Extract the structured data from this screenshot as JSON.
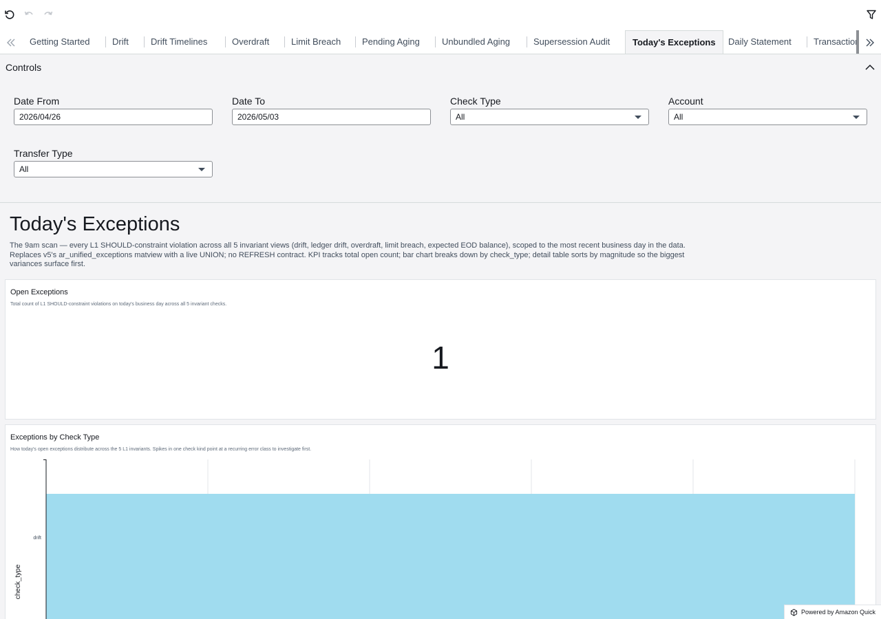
{
  "toolbar": {
    "icons": [
      "reset-icon",
      "undo-icon",
      "redo-icon",
      "filter-icon"
    ]
  },
  "tabs": [
    {
      "label": "Getting Started",
      "active": false
    },
    {
      "label": "Drift",
      "active": false
    },
    {
      "label": "Drift Timelines",
      "active": false
    },
    {
      "label": "Overdraft",
      "active": false
    },
    {
      "label": "Limit Breach",
      "active": false
    },
    {
      "label": "Pending Aging",
      "active": false
    },
    {
      "label": "Unbundled Aging",
      "active": false
    },
    {
      "label": "Supersession Audit",
      "active": false
    },
    {
      "label": "Today's Exceptions",
      "active": true
    },
    {
      "label": "Daily Statement",
      "active": false
    },
    {
      "label": "Transactions",
      "active": false
    }
  ],
  "controls": {
    "title": "Controls",
    "date_from": {
      "label": "Date From",
      "value": "2026/04/26"
    },
    "date_to": {
      "label": "Date To",
      "value": "2026/05/03"
    },
    "check_type": {
      "label": "Check Type",
      "value": "All"
    },
    "account": {
      "label": "Account",
      "value": "All"
    },
    "transfer_type": {
      "label": "Transfer Type",
      "value": "All"
    }
  },
  "sheet": {
    "title": "Today's Exceptions",
    "description": "The 9am scan — every L1 SHOULD-constraint violation across all 5 invariant views (drift, ledger drift, overdraft, limit breach, expected EOD balance), scoped to the most recent business day in the data. Replaces v5's ar_unified_exceptions matview with a live UNION; no REFRESH contract. KPI tracks total open count; bar chart breaks down by check_type; detail table sorts by magnitude so the biggest variances surface first."
  },
  "kpi": {
    "title": "Open Exceptions",
    "subtitle": "Total count of L1 SHOULD-constraint violations on today's business day across all 5 invariant checks.",
    "value": "1"
  },
  "bar_visual": {
    "title": "Exceptions by Check Type",
    "subtitle": "How today's open exceptions distribute across the 5 L1 invariants. Spikes in one check kind point at a recurring error class to investigate first."
  },
  "chart_data": {
    "type": "bar",
    "orientation": "horizontal",
    "categories": [
      "drift"
    ],
    "values": [
      1
    ],
    "ylabel": "check_type",
    "xlim": [
      0,
      1
    ],
    "grid": true,
    "bar_color": "#a0dcef"
  },
  "footer": {
    "powered_by": "Powered by Amazon Quick"
  }
}
